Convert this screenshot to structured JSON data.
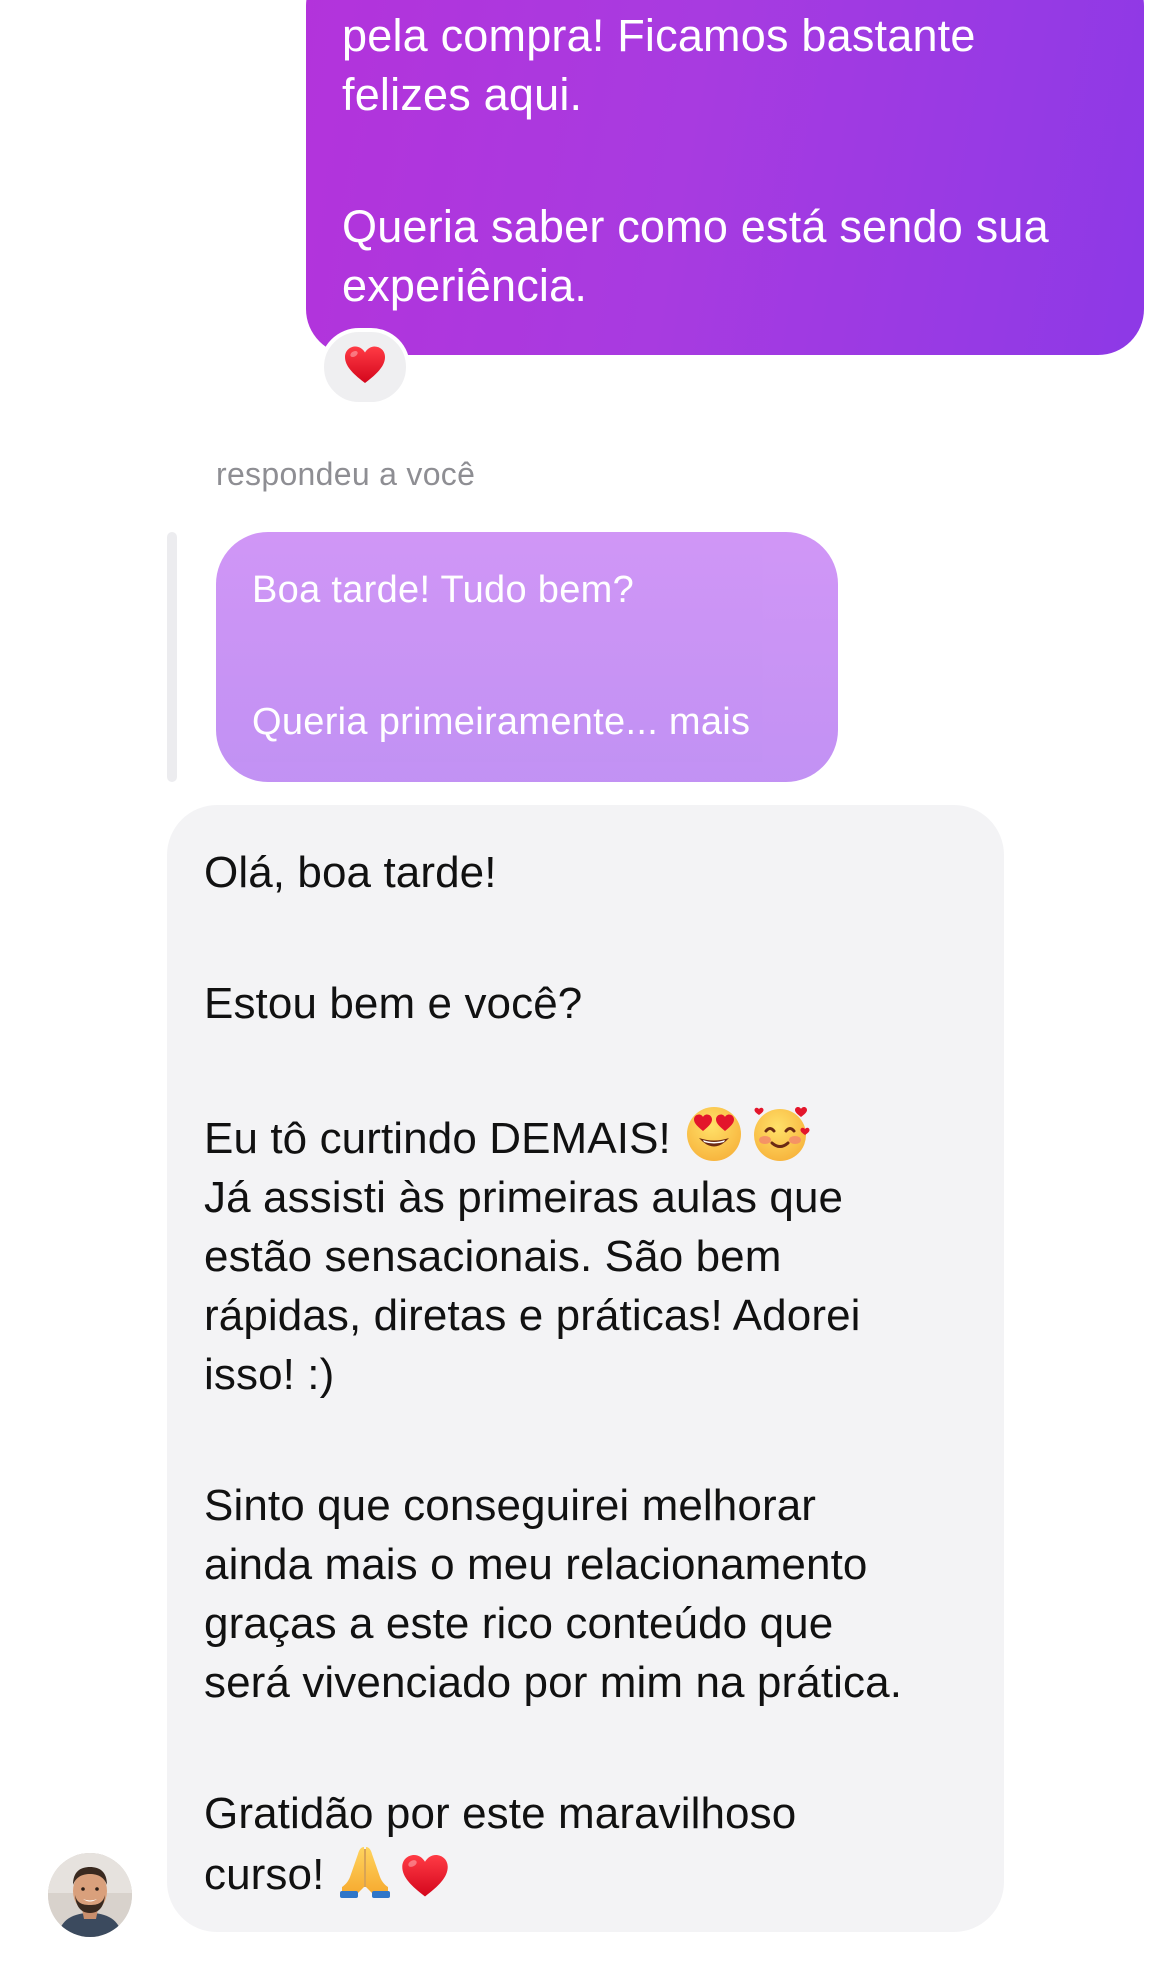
{
  "sent_message": {
    "lines": [
      "pela compra! Ficamos bastante",
      "felizes aqui.",
      "Queria saber como está sendo sua",
      "experiência."
    ]
  },
  "reaction": {
    "icon": "red-heart-icon",
    "color": "#e8112d"
  },
  "reply": {
    "label": "respondeu a você",
    "quoted_line_1": "Boa tarde! Tudo bem?",
    "quoted_line_2": "Queria primeiramente... mais"
  },
  "received_message": {
    "lines": {
      "l1": "Olá, boa tarde!",
      "l2": "Estou bem e você?",
      "l3": "Eu tô curtindo DEMAIS!",
      "l4": "Já assisti às primeiras aulas que",
      "l5": "estão sensacionais. São bem",
      "l6": "rápidas, diretas e práticas! Adorei",
      "l7": "isso! :)",
      "l8": "Sinto que conseguirei melhorar",
      "l9": "ainda mais o meu relacionamento",
      "l10": "graças a este rico conteúdo que",
      "l11": "será vivenciado por mim na prática.",
      "l12": "Gratidão por este maravilhoso",
      "l13": "curso!"
    },
    "emojis_line_3": [
      "heart-eyes-emoji",
      "smiling-face-with-hearts-emoji"
    ],
    "emojis_last_line": [
      "folded-hands-emoji",
      "red-heart-emoji"
    ]
  },
  "colors": {
    "sent_bubble": "#a83be0",
    "quoted_bubble": "#c890f5",
    "received_bubble": "#f3f3f5",
    "meta_text": "#8e8e93"
  }
}
